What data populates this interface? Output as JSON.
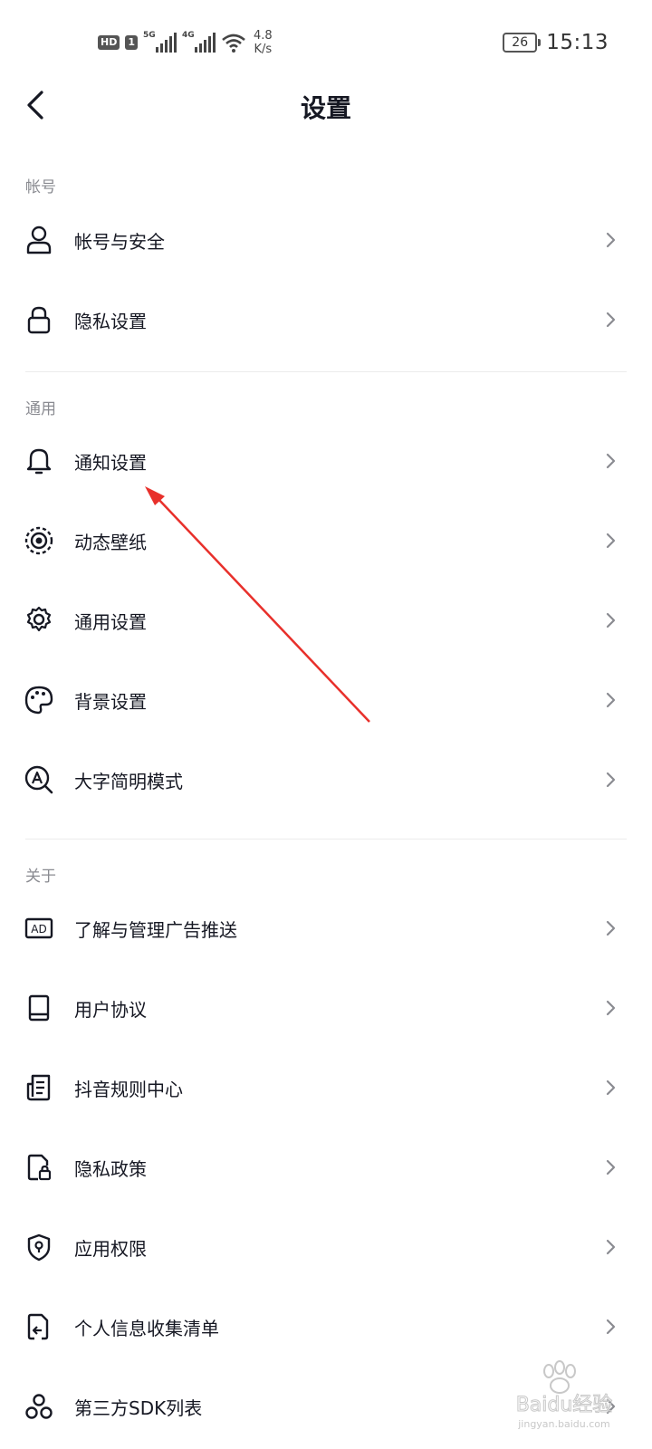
{
  "status_bar": {
    "hd_label": "HD",
    "sim_label": "1",
    "net1": "5G",
    "net2": "4G",
    "speed_value": "4.8",
    "speed_unit": "K/s",
    "battery": "26",
    "time": "15:13"
  },
  "header": {
    "title": "设置"
  },
  "sections": [
    {
      "label": "帐号",
      "items": [
        {
          "label": "帐号与安全",
          "icon": "person-icon"
        },
        {
          "label": "隐私设置",
          "icon": "lock-icon"
        }
      ]
    },
    {
      "label": "通用",
      "items": [
        {
          "label": "通知设置",
          "icon": "bell-icon"
        },
        {
          "label": "动态壁纸",
          "icon": "wallpaper-icon"
        },
        {
          "label": "通用设置",
          "icon": "gear-icon"
        },
        {
          "label": "背景设置",
          "icon": "palette-icon"
        },
        {
          "label": "大字简明模式",
          "icon": "large-text-icon"
        }
      ]
    },
    {
      "label": "关于",
      "items": [
        {
          "label": "了解与管理广告推送",
          "icon": "ad-icon"
        },
        {
          "label": "用户协议",
          "icon": "book-icon"
        },
        {
          "label": "抖音规则中心",
          "icon": "document-icon"
        },
        {
          "label": "隐私政策",
          "icon": "privacy-doc-icon"
        },
        {
          "label": "应用权限",
          "icon": "shield-icon"
        },
        {
          "label": "个人信息收集清单",
          "icon": "file-arrow-icon"
        },
        {
          "label": "第三方SDK列表",
          "icon": "sdk-icon"
        }
      ]
    }
  ],
  "watermark": {
    "text": "Baidu经验",
    "url": "jingyan.baidu.com"
  },
  "colors": {
    "text": "#161823",
    "section_label": "#8a8b91",
    "chevron": "#8a8b91",
    "arrow": "#e8302b",
    "divider": "#ececec"
  }
}
